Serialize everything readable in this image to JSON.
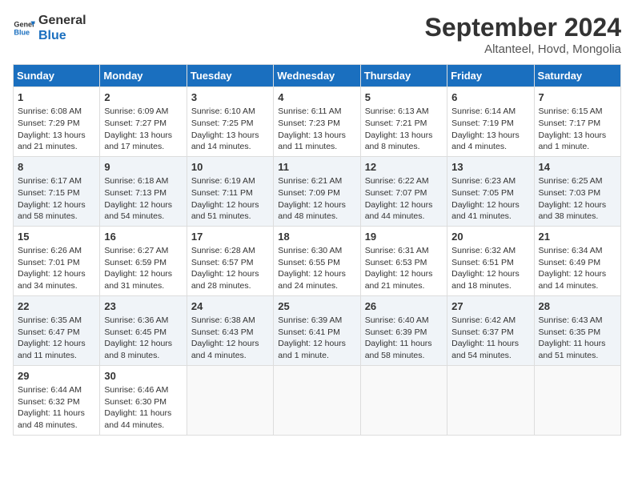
{
  "header": {
    "logo_line1": "General",
    "logo_line2": "Blue",
    "month_title": "September 2024",
    "location": "Altanteel, Hovd, Mongolia"
  },
  "days_of_week": [
    "Sunday",
    "Monday",
    "Tuesday",
    "Wednesday",
    "Thursday",
    "Friday",
    "Saturday"
  ],
  "weeks": [
    [
      {
        "day": "1",
        "info": "Sunrise: 6:08 AM\nSunset: 7:29 PM\nDaylight: 13 hours and 21 minutes."
      },
      {
        "day": "2",
        "info": "Sunrise: 6:09 AM\nSunset: 7:27 PM\nDaylight: 13 hours and 17 minutes."
      },
      {
        "day": "3",
        "info": "Sunrise: 6:10 AM\nSunset: 7:25 PM\nDaylight: 13 hours and 14 minutes."
      },
      {
        "day": "4",
        "info": "Sunrise: 6:11 AM\nSunset: 7:23 PM\nDaylight: 13 hours and 11 minutes."
      },
      {
        "day": "5",
        "info": "Sunrise: 6:13 AM\nSunset: 7:21 PM\nDaylight: 13 hours and 8 minutes."
      },
      {
        "day": "6",
        "info": "Sunrise: 6:14 AM\nSunset: 7:19 PM\nDaylight: 13 hours and 4 minutes."
      },
      {
        "day": "7",
        "info": "Sunrise: 6:15 AM\nSunset: 7:17 PM\nDaylight: 13 hours and 1 minute."
      }
    ],
    [
      {
        "day": "8",
        "info": "Sunrise: 6:17 AM\nSunset: 7:15 PM\nDaylight: 12 hours and 58 minutes."
      },
      {
        "day": "9",
        "info": "Sunrise: 6:18 AM\nSunset: 7:13 PM\nDaylight: 12 hours and 54 minutes."
      },
      {
        "day": "10",
        "info": "Sunrise: 6:19 AM\nSunset: 7:11 PM\nDaylight: 12 hours and 51 minutes."
      },
      {
        "day": "11",
        "info": "Sunrise: 6:21 AM\nSunset: 7:09 PM\nDaylight: 12 hours and 48 minutes."
      },
      {
        "day": "12",
        "info": "Sunrise: 6:22 AM\nSunset: 7:07 PM\nDaylight: 12 hours and 44 minutes."
      },
      {
        "day": "13",
        "info": "Sunrise: 6:23 AM\nSunset: 7:05 PM\nDaylight: 12 hours and 41 minutes."
      },
      {
        "day": "14",
        "info": "Sunrise: 6:25 AM\nSunset: 7:03 PM\nDaylight: 12 hours and 38 minutes."
      }
    ],
    [
      {
        "day": "15",
        "info": "Sunrise: 6:26 AM\nSunset: 7:01 PM\nDaylight: 12 hours and 34 minutes."
      },
      {
        "day": "16",
        "info": "Sunrise: 6:27 AM\nSunset: 6:59 PM\nDaylight: 12 hours and 31 minutes."
      },
      {
        "day": "17",
        "info": "Sunrise: 6:28 AM\nSunset: 6:57 PM\nDaylight: 12 hours and 28 minutes."
      },
      {
        "day": "18",
        "info": "Sunrise: 6:30 AM\nSunset: 6:55 PM\nDaylight: 12 hours and 24 minutes."
      },
      {
        "day": "19",
        "info": "Sunrise: 6:31 AM\nSunset: 6:53 PM\nDaylight: 12 hours and 21 minutes."
      },
      {
        "day": "20",
        "info": "Sunrise: 6:32 AM\nSunset: 6:51 PM\nDaylight: 12 hours and 18 minutes."
      },
      {
        "day": "21",
        "info": "Sunrise: 6:34 AM\nSunset: 6:49 PM\nDaylight: 12 hours and 14 minutes."
      }
    ],
    [
      {
        "day": "22",
        "info": "Sunrise: 6:35 AM\nSunset: 6:47 PM\nDaylight: 12 hours and 11 minutes."
      },
      {
        "day": "23",
        "info": "Sunrise: 6:36 AM\nSunset: 6:45 PM\nDaylight: 12 hours and 8 minutes."
      },
      {
        "day": "24",
        "info": "Sunrise: 6:38 AM\nSunset: 6:43 PM\nDaylight: 12 hours and 4 minutes."
      },
      {
        "day": "25",
        "info": "Sunrise: 6:39 AM\nSunset: 6:41 PM\nDaylight: 12 hours and 1 minute."
      },
      {
        "day": "26",
        "info": "Sunrise: 6:40 AM\nSunset: 6:39 PM\nDaylight: 11 hours and 58 minutes."
      },
      {
        "day": "27",
        "info": "Sunrise: 6:42 AM\nSunset: 6:37 PM\nDaylight: 11 hours and 54 minutes."
      },
      {
        "day": "28",
        "info": "Sunrise: 6:43 AM\nSunset: 6:35 PM\nDaylight: 11 hours and 51 minutes."
      }
    ],
    [
      {
        "day": "29",
        "info": "Sunrise: 6:44 AM\nSunset: 6:32 PM\nDaylight: 11 hours and 48 minutes."
      },
      {
        "day": "30",
        "info": "Sunrise: 6:46 AM\nSunset: 6:30 PM\nDaylight: 11 hours and 44 minutes."
      },
      null,
      null,
      null,
      null,
      null
    ]
  ]
}
